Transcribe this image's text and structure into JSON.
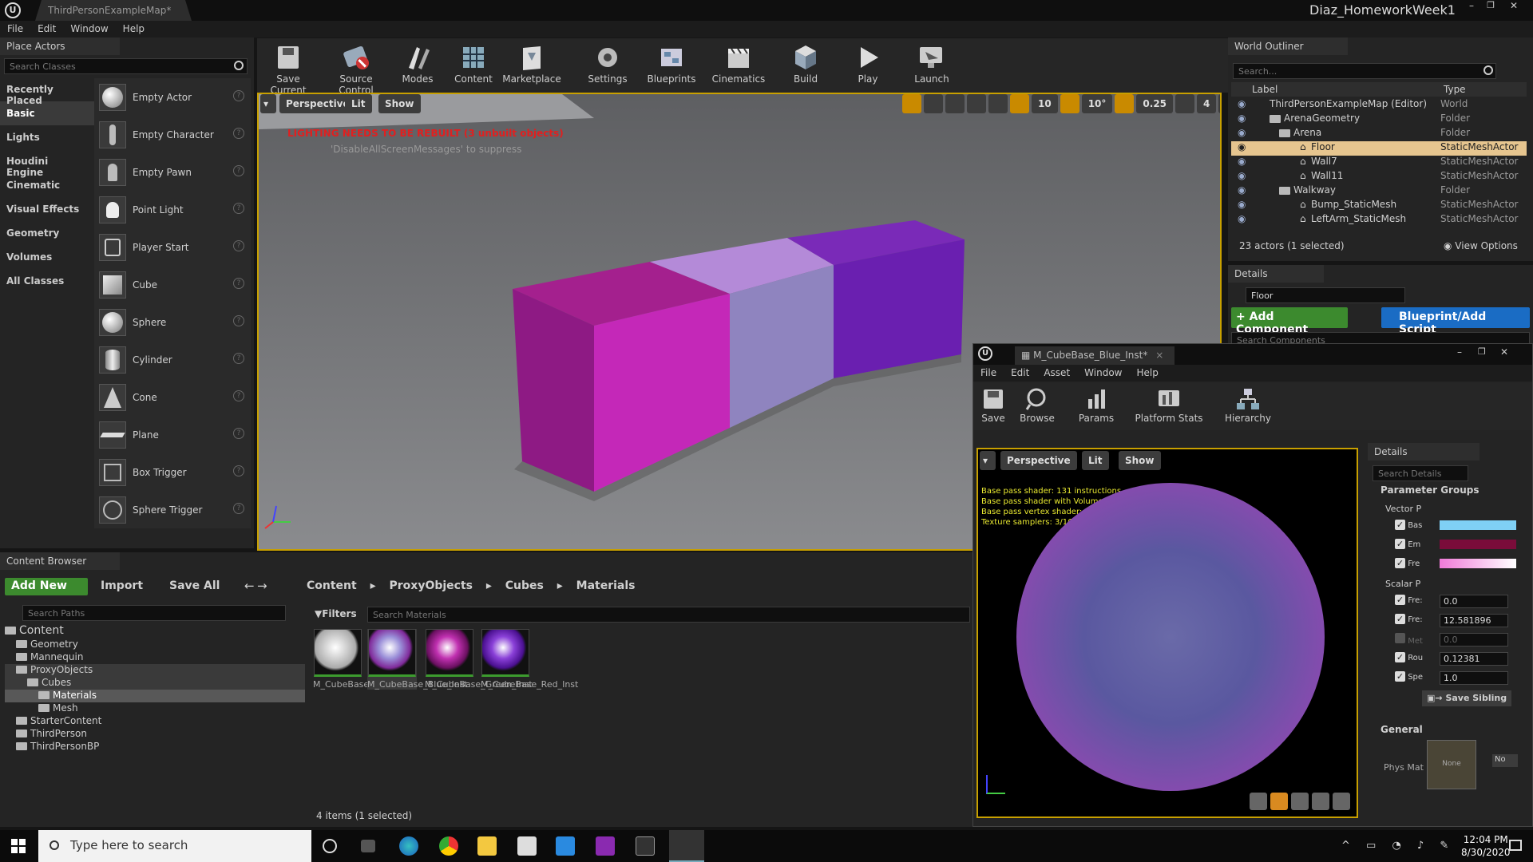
{
  "window": {
    "tab_title": "ThirdPersonExampleMap*",
    "project_name": "Diaz_HomeworkWeek1"
  },
  "menu": [
    "File",
    "Edit",
    "Window",
    "Help"
  ],
  "place_actors": {
    "title": "Place Actors",
    "search_placeholder": "Search Classes",
    "categories": [
      "Recently Placed",
      "Basic",
      "Lights",
      "Houdini Engine",
      "Cinematic",
      "Visual Effects",
      "Geometry",
      "Volumes",
      "All Classes"
    ],
    "selected_category": "Basic",
    "actors": [
      "Empty Actor",
      "Empty Character",
      "Empty Pawn",
      "Point Light",
      "Player Start",
      "Cube",
      "Sphere",
      "Cylinder",
      "Cone",
      "Plane",
      "Box Trigger",
      "Sphere Trigger"
    ]
  },
  "toolbar": {
    "buttons": [
      "Save Current",
      "Source Control",
      "Modes",
      "Content",
      "Marketplace",
      "Settings",
      "Blueprints",
      "Cinematics",
      "Build",
      "Play",
      "Launch"
    ]
  },
  "viewport": {
    "perspective": "Perspective",
    "lit": "Lit",
    "show": "Show",
    "warning": "LIGHTING NEEDS TO BE REBUILT (3 unbuilt objects)",
    "suppress": "'DisableAllScreenMessages' to suppress",
    "grid": "10",
    "angle": "10°",
    "scale": "0.25",
    "speed": "4"
  },
  "outliner": {
    "title": "World Outliner",
    "search_placeholder": "Search...",
    "col_label": "Label",
    "col_type": "Type",
    "rows": [
      {
        "label": "ThirdPersonExampleMap (Editor)",
        "type": "World"
      },
      {
        "label": "ArenaGeometry",
        "type": "Folder"
      },
      {
        "label": "Arena",
        "type": "Folder"
      },
      {
        "label": "Floor",
        "type": "StaticMeshActor"
      },
      {
        "label": "Wall7",
        "type": "StaticMeshActor"
      },
      {
        "label": "Wall11",
        "type": "StaticMeshActor"
      },
      {
        "label": "Walkway",
        "type": "Folder"
      },
      {
        "label": "Bump_StaticMesh",
        "type": "StaticMeshActor"
      },
      {
        "label": "LeftArm_StaticMesh",
        "type": "StaticMeshActor"
      }
    ],
    "count": "23 actors (1 selected)",
    "view_options": "View Options"
  },
  "details": {
    "title": "Details",
    "name": "Floor",
    "add_component": "+ Add Component",
    "blueprint": "Blueprint/Add Script",
    "search_components": "Search Components"
  },
  "content_browser": {
    "title": "Content Browser",
    "add_new": "Add New",
    "import": "Import",
    "save_all": "Save All",
    "path": [
      "Content",
      "ProxyObjects",
      "Cubes",
      "Materials"
    ],
    "search_paths": "Search Paths",
    "filters": "Filters",
    "search_materials": "Search Materials",
    "tree": [
      "Content",
      "Geometry",
      "Mannequin",
      "ProxyObjects",
      "Cubes",
      "Materials",
      "Mesh",
      "StarterContent",
      "ThirdPerson",
      "ThirdPersonBP"
    ],
    "assets": [
      "M_CubeBase",
      "M_CubeBase_Blue_Inst",
      "M_CubeBase_Green_Inst",
      "M_CubeBase_Red_Inst"
    ],
    "status": "4 items (1 selected)"
  },
  "material_editor": {
    "tab": "M_CubeBase_Blue_Inst*",
    "menu": [
      "File",
      "Edit",
      "Asset",
      "Window",
      "Help"
    ],
    "toolbar": [
      "Save",
      "Browse",
      "Params",
      "Platform Stats",
      "Hierarchy"
    ],
    "perspective": "Perspective",
    "lit": "Lit",
    "show": "Show",
    "stats": [
      "Base pass shader: 131 instructions",
      "Base pass shader with Volumetric Lightmap: 205 instructions",
      "Base pass vertex shader: 40 instructions",
      "Texture samplers: 3/16"
    ],
    "details_title": "Details",
    "search_details": "Search Details",
    "parameter_groups": "Parameter Groups",
    "vector_group": "Vector P",
    "vector_params": [
      {
        "name": "Bas",
        "color": "#7fd0f5"
      },
      {
        "name": "Em",
        "color": "#7a0c3a"
      },
      {
        "name": "Fre",
        "color": "#f07ad8"
      }
    ],
    "scalar_group": "Scalar P",
    "scalar_params": [
      {
        "name": "Fre:",
        "value": "0.0"
      },
      {
        "name": "Fre:",
        "value": "12.581896"
      },
      {
        "name": "Met",
        "value": "0.0"
      },
      {
        "name": "Rou",
        "value": "0.12381"
      },
      {
        "name": "Spe",
        "value": "1.0"
      }
    ],
    "save_sibling": "Save Sibling",
    "general": "General",
    "phys_mat": "Phys Mat",
    "none": "None",
    "no": "No"
  },
  "taskbar": {
    "search": "Type here to search",
    "time": "12:04 PM",
    "date": "8/30/2020"
  }
}
